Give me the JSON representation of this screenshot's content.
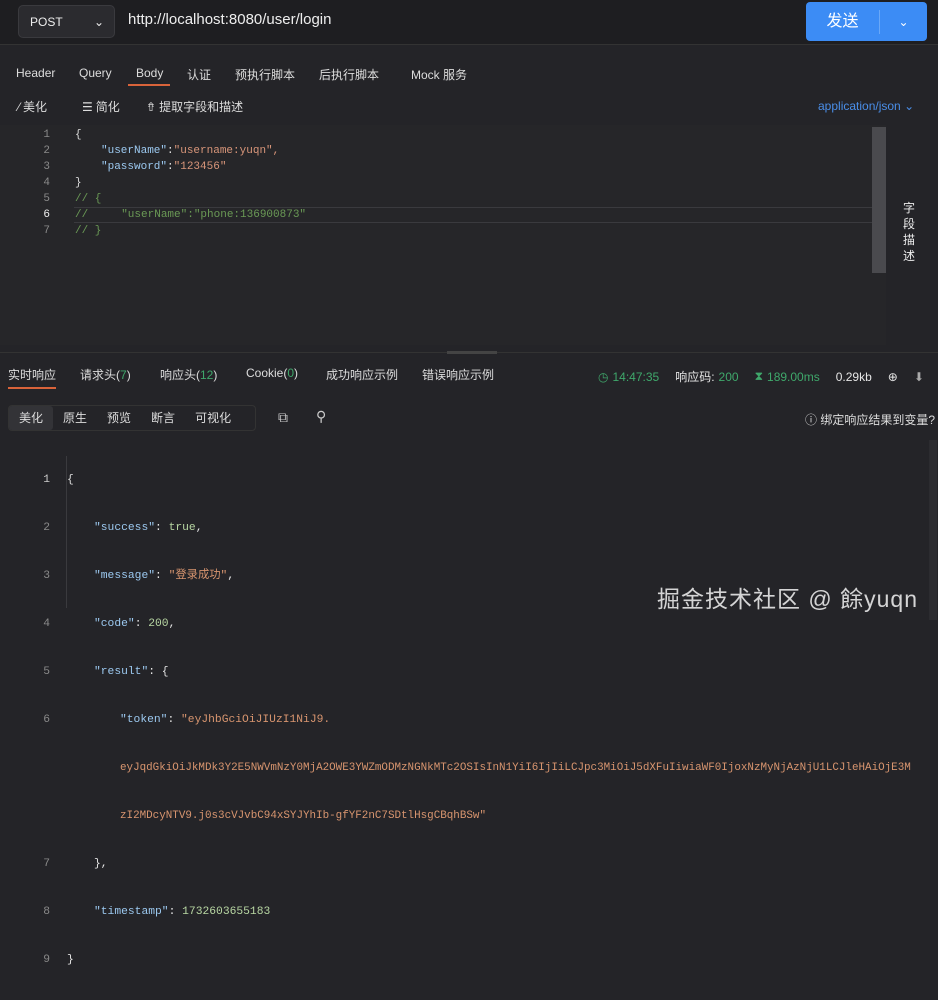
{
  "request": {
    "method": "POST",
    "url": "http://localhost:8080/user/login",
    "send_label": "发送"
  },
  "tabs": [
    "Header",
    "Query",
    "Body",
    "认证",
    "预执行脚本",
    "后执行脚本",
    "Mock 服务"
  ],
  "body_toolbar": {
    "beautify": "美化",
    "simplify": "简化",
    "extract": "提取字段和描述",
    "content_type": "application/json"
  },
  "body_lines": [
    {
      "n": "1",
      "html": "{"
    },
    {
      "n": "2",
      "key": "\"userName\"",
      "val": "\"username:yuqn\","
    },
    {
      "n": "3",
      "key": "\"password\"",
      "val": "\"123456\""
    },
    {
      "n": "4",
      "html": "}"
    },
    {
      "n": "5",
      "comment": "// {"
    },
    {
      "n": "6",
      "comment": "//     \"userName\":\"phone:136900873\""
    },
    {
      "n": "7",
      "comment": "// }"
    }
  ],
  "field_desc_label": "字段描述",
  "response_tabs": {
    "realtime": "实时响应",
    "req_headers": "请求头(",
    "req_headers_count": "7",
    "resp_headers": "响应头(",
    "resp_headers_count": "12",
    "cookie": "Cookie(",
    "cookie_count": "0",
    "close_paren": ")",
    "success_example": "成功响应示例",
    "error_example": "错误响应示例"
  },
  "status": {
    "time": "14:47:35",
    "code_label": "响应码:",
    "code": "200",
    "duration": "189.00ms",
    "size": "0.29kb"
  },
  "view_modes": [
    "美化",
    "原生",
    "预览",
    "断言",
    "可视化"
  ],
  "bind_var_label": "绑定响应结果到变量?",
  "response": {
    "success": "true",
    "message": "\"登录成功\"",
    "code": "200",
    "token_1": "\"eyJhbGciOiJIUzI1NiJ9.",
    "token_2": "eyJqdGkiOiJkMDk3Y2E5NWVmNzY0MjA2OWE3YWZmODMzNGNkMTc2OSIsInN1YiI6IjIiLCJpc3MiOiJ5dXFuIiwiaWF0IjoxNzMyNjAzNjU1LCJleHAiOjE3M",
    "token_3": "zI2MDcyNTV9.j0s3cVJvbC94xSYJYhIb-gfYF2nC7SDtlHsgCBqhBSw\"",
    "timestamp": "1732603655183"
  },
  "watermark": "掘金技术社区 @ 餘yuqn"
}
